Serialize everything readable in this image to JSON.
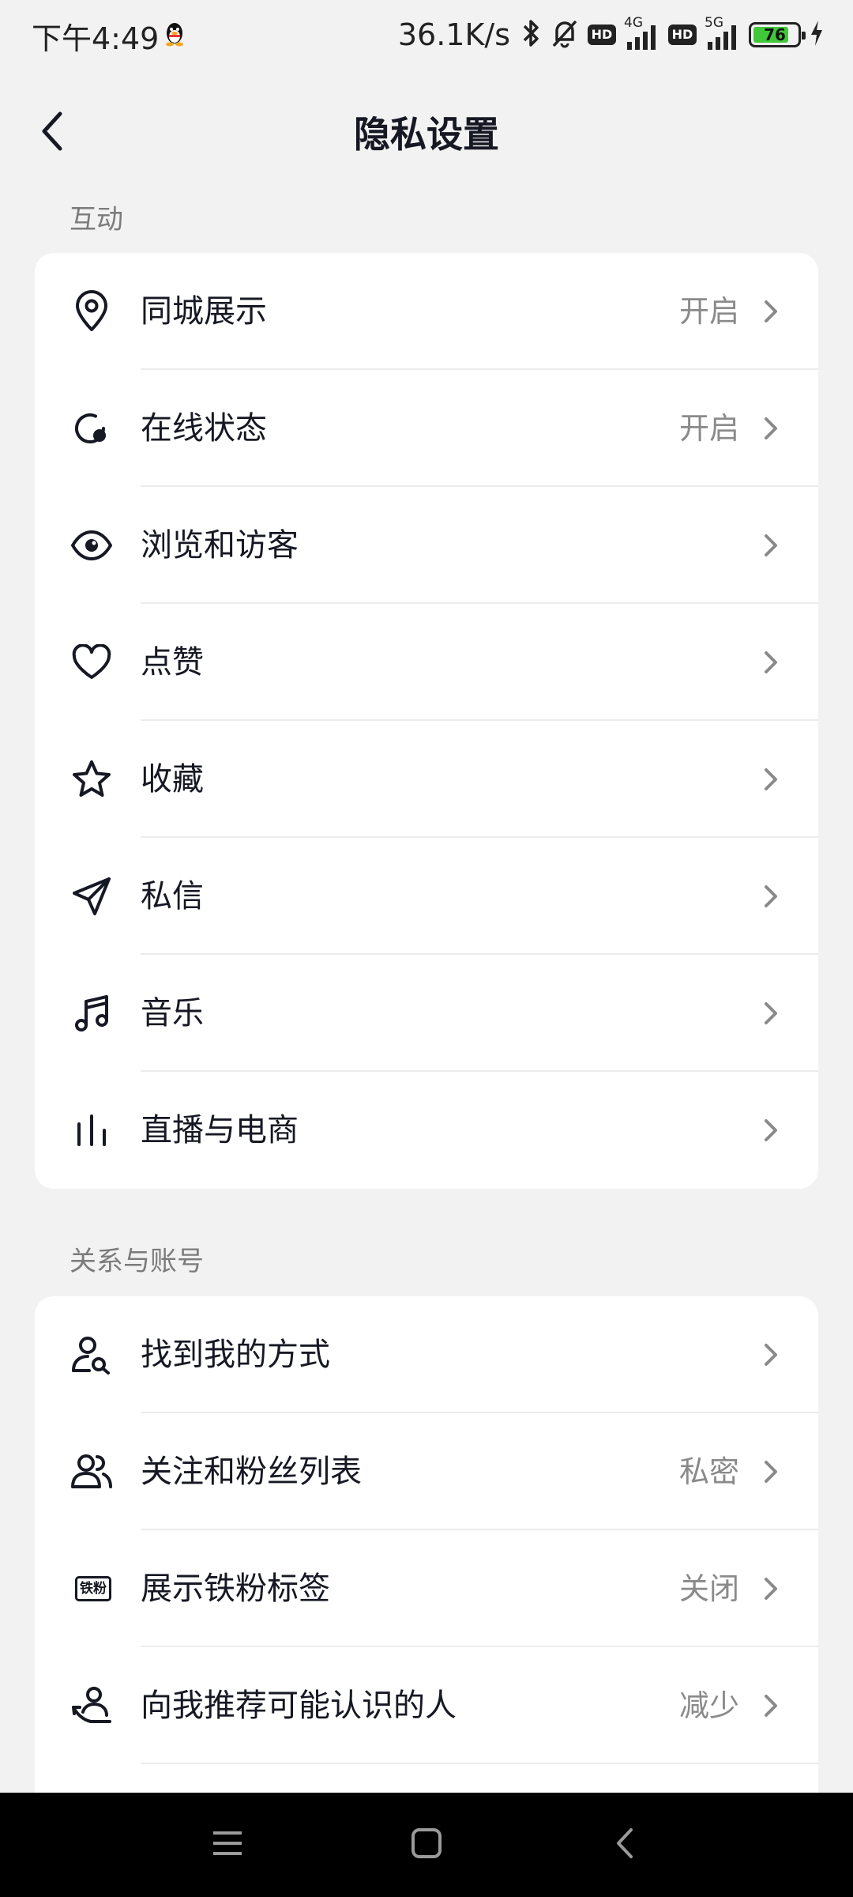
{
  "status_bar": {
    "time": "下午4:49",
    "net_speed": "36.1K/s",
    "hd1": "HD",
    "hd2": "HD",
    "net1": "4G",
    "net2": "5G",
    "battery": "76"
  },
  "header": {
    "title": "隐私设置"
  },
  "sections": {
    "interaction": {
      "label": "互动",
      "items": [
        {
          "label": "同城展示",
          "value": "开启",
          "icon": "location-icon"
        },
        {
          "label": "在线状态",
          "value": "开启",
          "icon": "online-status-icon"
        },
        {
          "label": "浏览和访客",
          "value": "",
          "icon": "eye-icon"
        },
        {
          "label": "点赞",
          "value": "",
          "icon": "heart-icon"
        },
        {
          "label": "收藏",
          "value": "",
          "icon": "star-icon"
        },
        {
          "label": "私信",
          "value": "",
          "icon": "send-icon"
        },
        {
          "label": "音乐",
          "value": "",
          "icon": "music-icon"
        },
        {
          "label": "直播与电商",
          "value": "",
          "icon": "bars-icon"
        }
      ]
    },
    "relationship": {
      "label": "关系与账号",
      "items": [
        {
          "label": "找到我的方式",
          "value": "",
          "icon": "person-search-icon"
        },
        {
          "label": "关注和粉丝列表",
          "value": "私密",
          "icon": "people-icon"
        },
        {
          "label": "展示铁粉标签",
          "value": "关闭",
          "icon": "fan-badge-icon",
          "badge_text": "铁粉"
        },
        {
          "label": "向我推荐可能认识的人",
          "value": "减少",
          "icon": "recommend-people-icon"
        }
      ]
    }
  },
  "colors": {
    "background": "#f2f2f2",
    "card": "#ffffff",
    "text": "#161823",
    "secondary": "#8a8a8a"
  }
}
